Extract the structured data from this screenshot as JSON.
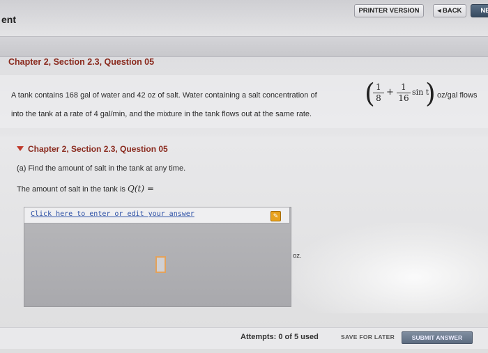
{
  "header": {
    "left_text": "ent"
  },
  "toolbar": {
    "printer_label": "PRINTER VERSION",
    "back_label": "◂ BACK",
    "next_label": "NE"
  },
  "question": {
    "chapter_title": "Chapter 2, Section 2.3, Question 05",
    "text_line1": "A tank contains 168 gal of water and 42 oz of salt. Water containing a salt concentration of",
    "text_units": "oz/gal flows",
    "text_line2": "into the tank at a rate of 4 gal/min, and the mixture in the tank flows out at the same rate.",
    "formula": {
      "frac1_num": "1",
      "frac1_den": "8",
      "plus": "+",
      "frac2_num": "1",
      "frac2_den": "16",
      "trig": "sin t"
    }
  },
  "subpanel": {
    "title": "Chapter 2, Section 2.3, Question 05",
    "part_a": "(a) Find the amount of salt in the tank at any time.",
    "amount_prefix": "The amount of salt in the tank is",
    "amount_expr": "Q(t) =",
    "edit_link": "Click here to enter or edit your answer",
    "unit": "oz."
  },
  "footer": {
    "attempts": "Attempts: 0 of 5 used",
    "save_later": "SAVE FOR LATER",
    "submit": "SUBMIT ANSWER"
  },
  "colors": {
    "title_red": "#8a2a1e",
    "link_blue": "#2b4fa5",
    "edit_orange": "#e7a11e"
  }
}
